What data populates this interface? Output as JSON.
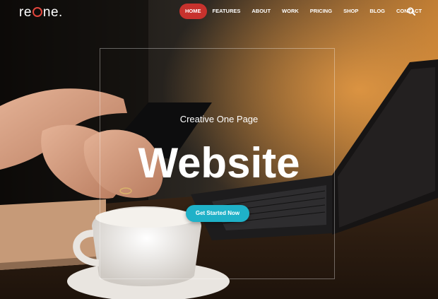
{
  "brand": {
    "logo_prefix": "re",
    "logo_suffix": "ne",
    "logo_dot": ".",
    "accent": "#e0453c"
  },
  "nav": {
    "items": [
      {
        "label": "HOME",
        "active": true
      },
      {
        "label": "FEATURES",
        "active": false
      },
      {
        "label": "ABOUT",
        "active": false
      },
      {
        "label": "WORK",
        "active": false
      },
      {
        "label": "PRICING",
        "active": false
      },
      {
        "label": "SHOP",
        "active": false
      },
      {
        "label": "BLOG",
        "active": false
      },
      {
        "label": "CONTACT",
        "active": false
      }
    ],
    "active_color": "#c7322d",
    "search_icon": "search-icon"
  },
  "hero": {
    "subtitle": "Creative One Page",
    "title": "Website",
    "cta_label": "Get Started Now",
    "cta_color": "#1fb1c8"
  }
}
